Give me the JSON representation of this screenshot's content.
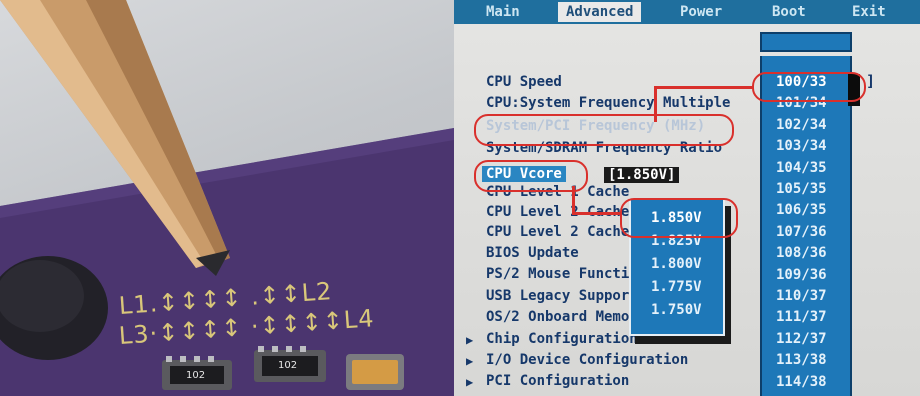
{
  "photo": {
    "silkscreen_row1": "L1.↕↕↕↕  .↕↕L2",
    "silkscreen_row2": "L3·↕↕↕↕  ·↕↕↕↕L4",
    "chip_label_1": "102",
    "chip_label_2": "102"
  },
  "bios": {
    "menu": [
      "Main",
      "Advanced",
      "Power",
      "Boot",
      "Exit"
    ],
    "active_menu": "Advanced",
    "items": [
      "CPU Speed",
      "CPU:System Frequency Multiple",
      "System/PCI Frequency (MHz)",
      "System/SDRAM Frequency Ratio",
      "CPU Vcore",
      "CPU Level 1 Cache",
      "CPU Level 2 Cache",
      "CPU Level 2 Cache ECC",
      "BIOS Update",
      "PS/2 Mouse Function",
      "USB Legacy Support",
      "OS/2 Onboard Memory"
    ],
    "submenus": [
      "Chip Configuration",
      "I/O Device Configuration",
      "PCI Configuration"
    ],
    "vcore_value": "[1.850V]",
    "speed_options": [
      "100/33",
      "101/34",
      "102/34",
      "103/34",
      "104/35",
      "105/35",
      "106/35",
      "107/36",
      "108/36",
      "109/36",
      "110/37",
      "111/37",
      "112/37",
      "113/38",
      "114/38"
    ],
    "speed_selected": "100/33",
    "speed_bracket": "]",
    "voltage_options": [
      "1.850V",
      "1.825V",
      "1.800V",
      "1.775V",
      "1.750V"
    ],
    "voltage_selected": "1.850V"
  },
  "colors": {
    "bios_blue": "#1e78b8",
    "highlight_red": "#d9302c",
    "pcb_purple": "#4a3470"
  }
}
